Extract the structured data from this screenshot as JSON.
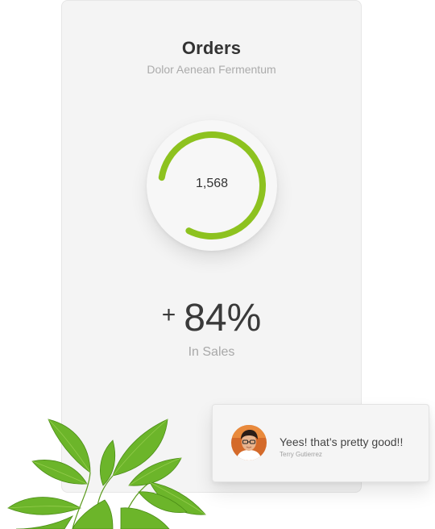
{
  "card": {
    "title": "Orders",
    "subtitle": "Dolor Aenean Fermentum",
    "gauge": {
      "value_label": "1,568",
      "progress": 0.8,
      "color": "#8dc21f"
    },
    "stat": {
      "sign": "+",
      "value": "84%",
      "label": "In Sales"
    }
  },
  "chat": {
    "message": "Yees! that’s pretty good!!",
    "author": "Terry Gutierrez",
    "avatar_icon": "user-avatar"
  },
  "decoration": {
    "plant_icon": "mint-leaves"
  }
}
